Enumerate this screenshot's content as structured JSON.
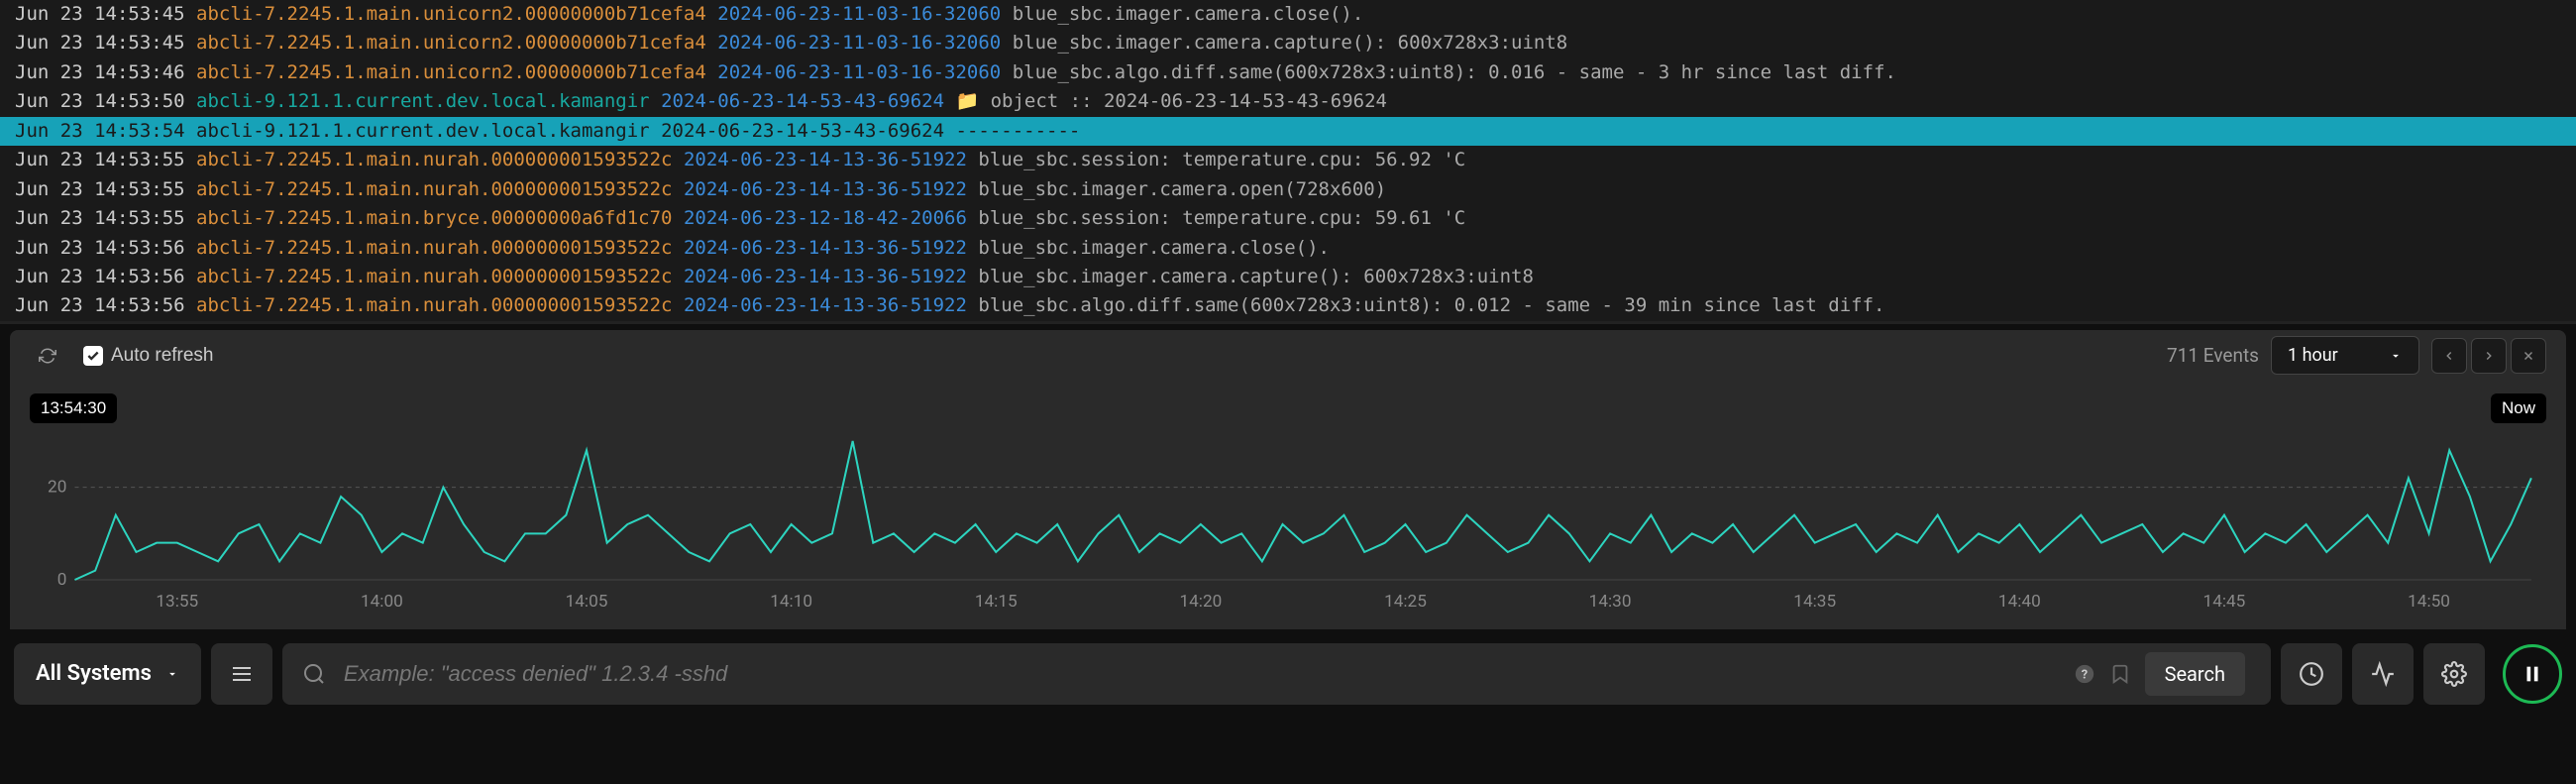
{
  "logs": [
    {
      "ts": "Jun 23 14:53:45",
      "source": "abcli-7.2245.1.main.unicorn2.00000000b71cefa4",
      "session": "2024-06-23-11-03-16-32060",
      "msg": "blue_sbc.imager.camera.close()."
    },
    {
      "ts": "Jun 23 14:53:45",
      "source": "abcli-7.2245.1.main.unicorn2.00000000b71cefa4",
      "session": "2024-06-23-11-03-16-32060",
      "msg": "blue_sbc.imager.camera.capture(): 600x728x3:uint8"
    },
    {
      "ts": "Jun 23 14:53:46",
      "source": "abcli-7.2245.1.main.unicorn2.00000000b71cefa4",
      "session": "2024-06-23-11-03-16-32060",
      "msg": "blue_sbc.algo.diff.same(600x728x3:uint8): 0.016 - same - 3 hr since last diff."
    },
    {
      "ts": "Jun 23 14:53:50",
      "source": "abcli-9.121.1.current.dev.local.kamangir",
      "session": "2024-06-23-14-53-43-69624",
      "msg": "📁 object :: 2024-06-23-14-53-43-69624",
      "alt": true
    },
    {
      "ts": "Jun 23 14:53:54",
      "source": "abcli-9.121.1.current.dev.local.kamangir",
      "session": "2024-06-23-14-53-43-69624",
      "msg": "-----------",
      "alt": true,
      "highlighted": true
    },
    {
      "ts": "Jun 23 14:53:55",
      "source": "abcli-7.2245.1.main.nurah.000000001593522c",
      "session": "2024-06-23-14-13-36-51922",
      "msg": "blue_sbc.session: temperature.cpu: 56.92 'C"
    },
    {
      "ts": "Jun 23 14:53:55",
      "source": "abcli-7.2245.1.main.nurah.000000001593522c",
      "session": "2024-06-23-14-13-36-51922",
      "msg": "blue_sbc.imager.camera.open(728x600)"
    },
    {
      "ts": "Jun 23 14:53:55",
      "source": "abcli-7.2245.1.main.bryce.00000000a6fd1c70",
      "session": "2024-06-23-12-18-42-20066",
      "msg": "blue_sbc.session: temperature.cpu: 59.61 'C"
    },
    {
      "ts": "Jun 23 14:53:56",
      "source": "abcli-7.2245.1.main.nurah.000000001593522c",
      "session": "2024-06-23-14-13-36-51922",
      "msg": "blue_sbc.imager.camera.close()."
    },
    {
      "ts": "Jun 23 14:53:56",
      "source": "abcli-7.2245.1.main.nurah.000000001593522c",
      "session": "2024-06-23-14-13-36-51922",
      "msg": "blue_sbc.imager.camera.capture(): 600x728x3:uint8"
    },
    {
      "ts": "Jun 23 14:53:56",
      "source": "abcli-7.2245.1.main.nurah.000000001593522c",
      "session": "2024-06-23-14-13-36-51922",
      "msg": "blue_sbc.algo.diff.same(600x728x3:uint8): 0.012 - same - 39 min since last diff."
    }
  ],
  "controls": {
    "auto_refresh_label": "Auto refresh",
    "events_count": "711 Events",
    "range_label": "1 hour"
  },
  "chart_data": {
    "type": "line",
    "title": "",
    "xlabel": "",
    "ylabel": "",
    "ylim": [
      0,
      30
    ],
    "start_badge": "13:54:30",
    "end_badge": "Now",
    "xticks": [
      "13:55",
      "14:00",
      "14:05",
      "14:10",
      "14:15",
      "14:20",
      "14:25",
      "14:30",
      "14:35",
      "14:40",
      "14:45",
      "14:50"
    ],
    "ytick": 20,
    "values": [
      0,
      2,
      14,
      6,
      8,
      8,
      6,
      4,
      10,
      12,
      4,
      10,
      8,
      18,
      14,
      6,
      10,
      8,
      20,
      12,
      6,
      4,
      10,
      10,
      14,
      28,
      8,
      12,
      14,
      10,
      6,
      4,
      10,
      12,
      6,
      12,
      8,
      10,
      30,
      8,
      10,
      6,
      10,
      8,
      12,
      6,
      10,
      8,
      12,
      4,
      10,
      14,
      6,
      10,
      8,
      12,
      8,
      10,
      4,
      12,
      8,
      10,
      14,
      6,
      8,
      12,
      6,
      8,
      14,
      10,
      6,
      8,
      14,
      10,
      4,
      10,
      8,
      14,
      6,
      10,
      8,
      12,
      6,
      10,
      14,
      8,
      10,
      12,
      6,
      10,
      8,
      14,
      6,
      10,
      8,
      12,
      6,
      10,
      14,
      8,
      10,
      12,
      6,
      10,
      8,
      14,
      6,
      10,
      8,
      12,
      6,
      10,
      14,
      8,
      22,
      10,
      28,
      18,
      4,
      12,
      22
    ]
  },
  "search": {
    "systems_label": "All Systems",
    "placeholder": "Example: \"access denied\" 1.2.3.4 -sshd",
    "search_button": "Search"
  }
}
